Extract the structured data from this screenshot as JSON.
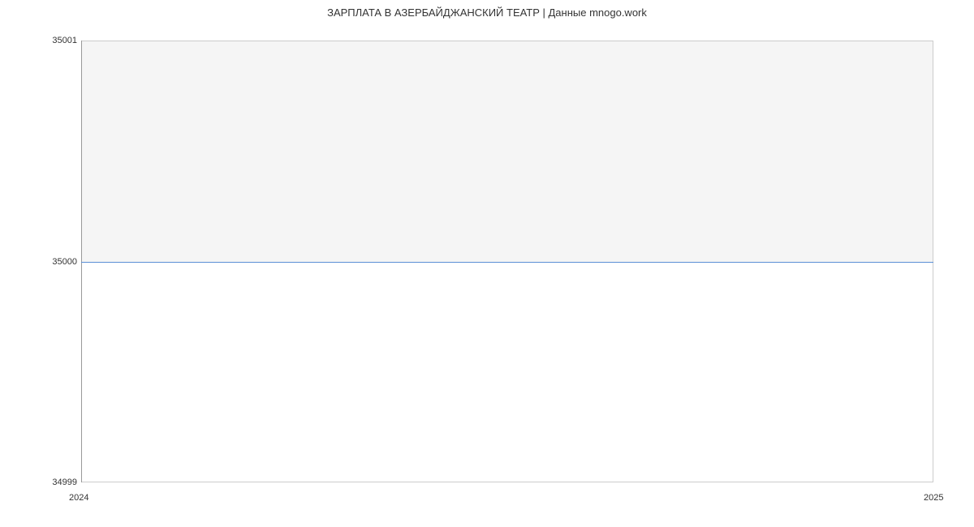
{
  "chart_data": {
    "type": "line",
    "title": "ЗАРПЛАТА В АЗЕРБАЙДЖАНСКИЙ ТЕАТР | Данные mnogo.work",
    "xlabel": "",
    "ylabel": "",
    "x": [
      2024,
      2025
    ],
    "values": [
      35000,
      35000
    ],
    "x_ticks": [
      "2024",
      "2025"
    ],
    "y_ticks": [
      "34999",
      "35000",
      "35001"
    ],
    "ylim": [
      34999,
      35001
    ],
    "xlim": [
      2024,
      2025
    ]
  }
}
